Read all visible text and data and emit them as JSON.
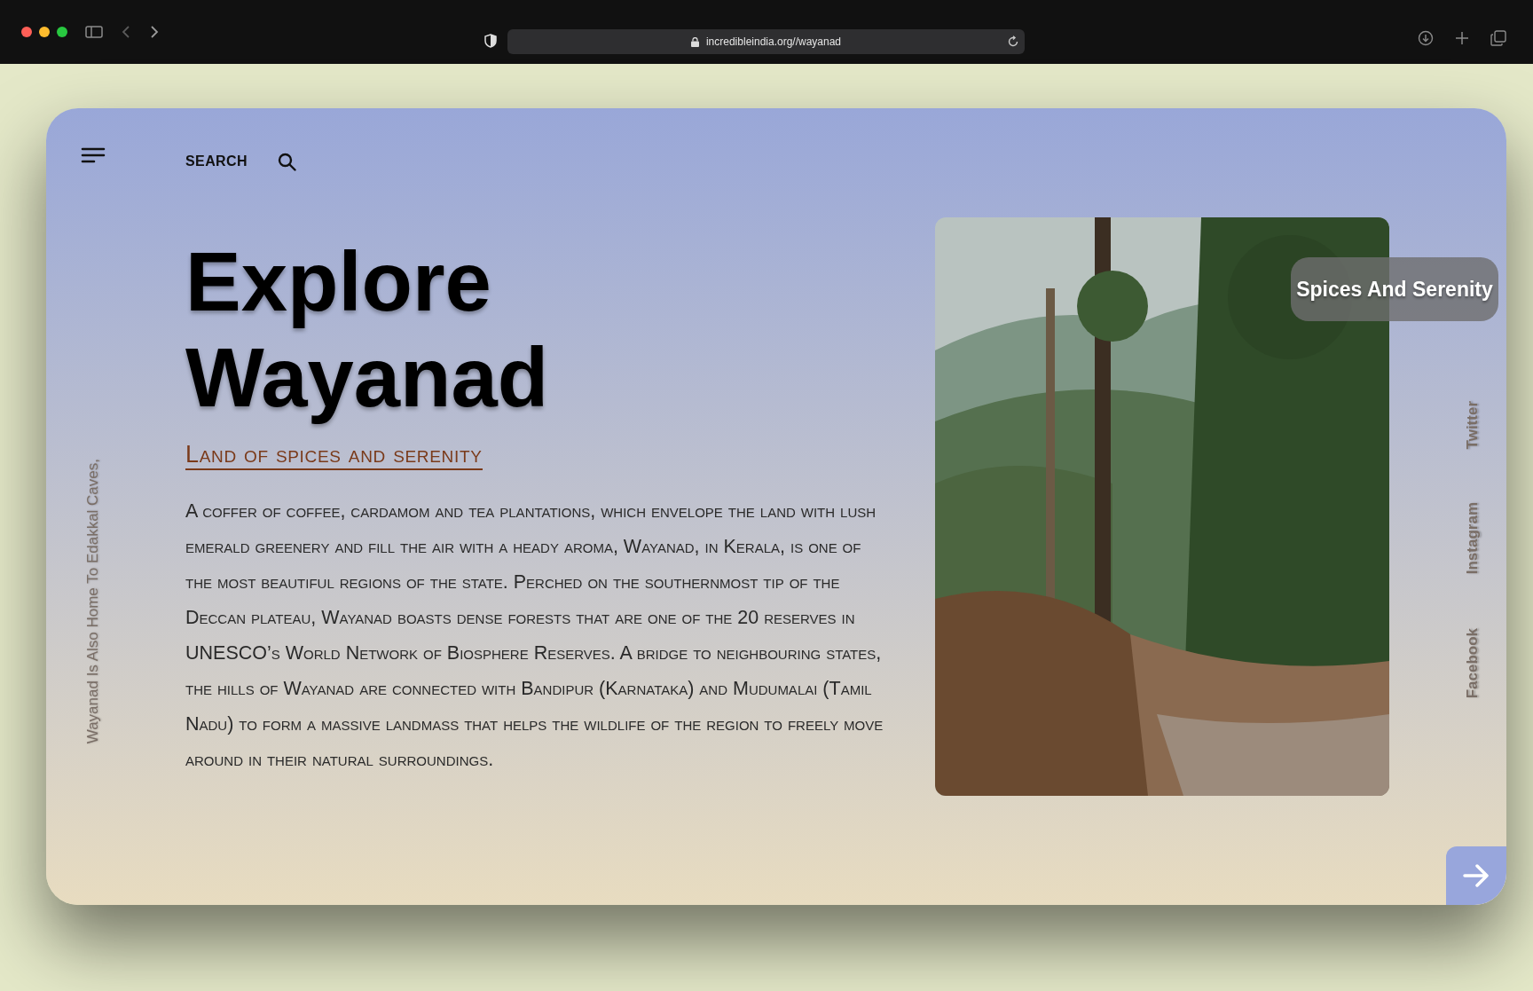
{
  "browser": {
    "url": "incredibleindia.org//wayanad"
  },
  "header": {
    "search_label": "SEARCH"
  },
  "side_note": "Wayanad Is Also Home To Edakkal Caves,",
  "title_lines": [
    "Explore",
    "Wayanad"
  ],
  "subtitle": "Land of spices and serenity",
  "description": "A coffer of coffee, cardamom and tea plantations, which envelope the land with lush emerald greenery and fill the air with a heady aroma, Wayanad, in Kerala, is one of the most beautiful regions of the state. Perched on the southernmost tip of the Deccan plateau, Wayanad boasts dense forests that are one of the 20 reserves in UNESCO’s World Network of Biosphere Reserves. A bridge to neighbouring states, the hills of Wayanad are connected with Bandipur (Karnataka) and Mudumalai (Tamil Nadu) to form a massive landmass that helps the wildlife of the region to freely move around in their natural surroundings.",
  "photo": {
    "caption": "Spices And Serenity"
  },
  "social_links": [
    "Twitter",
    "Instagram",
    "Facebook"
  ]
}
